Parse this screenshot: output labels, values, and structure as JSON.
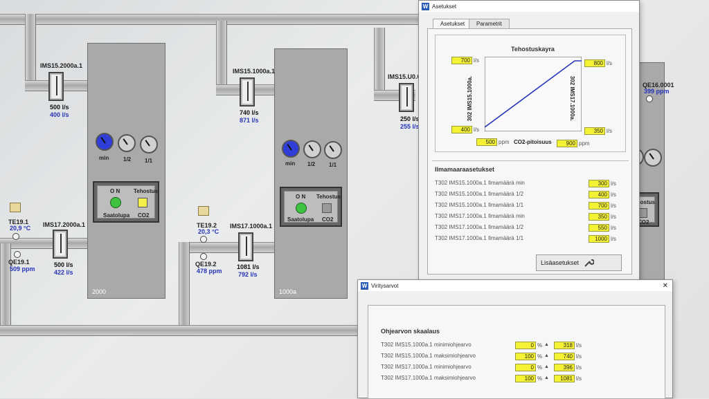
{
  "rooms": [
    {
      "id": "2000",
      "dampers": [
        {
          "tag": "IMS15.2000a.1",
          "flow1": "500 l/s",
          "flow2": "400 l/s"
        },
        {
          "tag": "IMS17.2000a.1",
          "flow1": "500 l/s",
          "flow2": "422 l/s"
        }
      ]
    },
    {
      "id": "1000a",
      "dampers": [
        {
          "tag": "IMS15.1000a.1",
          "flow1": "740 l/s",
          "flow2": "871 l/s"
        },
        {
          "tag": "IMS17.1000a.1",
          "flow1": "1081 l/s",
          "flow2": "792 l/s"
        }
      ]
    }
  ],
  "third_damper": {
    "tag": "IMS15.U0.0",
    "flow1": "250 l/s",
    "flow2": "255 l/s"
  },
  "qe16": {
    "tag": "QE16.0001",
    "value": "399 ppm"
  },
  "gauge_labels": [
    "min",
    "1/2",
    "1/1"
  ],
  "control": {
    "on_label": "O N",
    "boost_label": "Tehostus",
    "permit_label": "Saatolupa",
    "co2_label": "CO2",
    "on_color": "#3fc23f",
    "co2_active_color": "#f2ef4a",
    "co2_idle_color": "#9a9a9a"
  },
  "sensors": {
    "te19_1": {
      "tag": "TE19.1",
      "value": "20,9 °C"
    },
    "qe19_1": {
      "tag": "QE19.1",
      "value": "509 ppm"
    },
    "te19_2": {
      "tag": "TE19.2",
      "value": "20,3 °C"
    },
    "qe19_2": {
      "tag": "QE19.2",
      "value": "478 ppm"
    }
  },
  "asetukset_window": {
    "title": "Asetukset",
    "tabs": [
      "Asetukset",
      "Parametrit"
    ],
    "curve": {
      "title": "Tehostuskayra",
      "left_axis": "302 IMS15.1000a.",
      "right_axis": "302 IMS17.1000a.",
      "x_label": "CO2-pitoisuus",
      "y_left_max": "700",
      "y_left_min": "400",
      "y_right_max": "800",
      "y_right_min": "350",
      "x_min": "500",
      "x_max": "900",
      "unit_ls": "l/s",
      "unit_ppm": "ppm"
    },
    "settings_title": "Ilmamaaraasetukset",
    "settings_rows": [
      {
        "label": "T302 IMS15.1000a.1 Ilmamäärä min",
        "value": "300",
        "unit": "l/s"
      },
      {
        "label": "T302 IMS15.1000a.1 Ilmamäärä 1/2",
        "value": "400",
        "unit": "l/s"
      },
      {
        "label": "T302 IMS15.1000a.1 Ilmamäärä 1/1",
        "value": "700",
        "unit": "l/s"
      },
      {
        "label": "T302 IMS17.1000a.1 Ilmamäärä min",
        "value": "350",
        "unit": "l/s"
      },
      {
        "label": "T302 IMS17.1000a.1 Ilmamäärä 1/2",
        "value": "550",
        "unit": "l/s"
      },
      {
        "label": "T302 IMS17.1000a.1 Ilmamäärä 1/1",
        "value": "1000",
        "unit": "l/s"
      }
    ],
    "more_button": "Lisäasetukset"
  },
  "viritys_window": {
    "title": "Viritysarvot",
    "section_title": "Ohjearvon skaalaus",
    "rows": [
      {
        "label": "T302 IMS15.1000a.1 minimiohjearvo",
        "pct": "0",
        "flow": "318"
      },
      {
        "label": "T302 IMS15.1000a.1 maksimiohjearvo",
        "pct": "100",
        "flow": "740"
      },
      {
        "label": "T302 IMS17.1000a.1 minimiohjearvo",
        "pct": "0",
        "flow": "396"
      },
      {
        "label": "T302 IMS17.1000a.1 maksimiohjearvo",
        "pct": "100",
        "flow": "1081"
      }
    ],
    "pct_unit": "%",
    "flow_unit": "l/s"
  }
}
